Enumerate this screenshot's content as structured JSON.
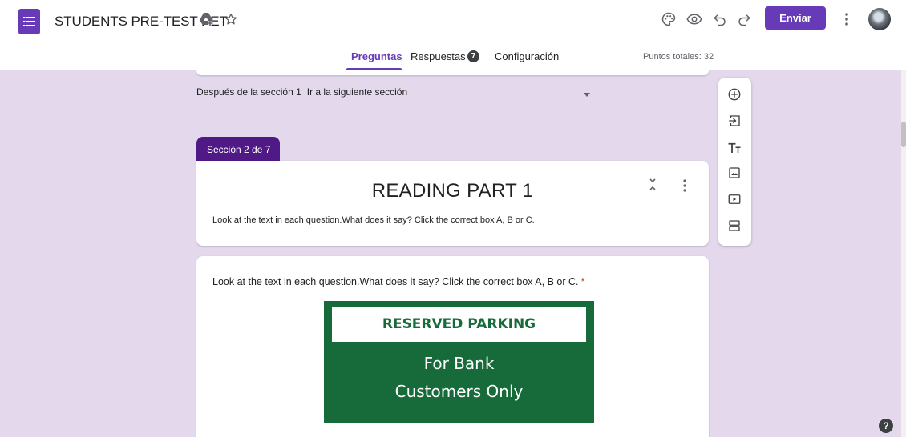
{
  "header": {
    "title": "STUDENTS PRE-TEST PET",
    "send_label": "Enviar",
    "icons": [
      "forms-logo-icon",
      "drive-icon",
      "star-icon",
      "palette-icon",
      "preview-icon",
      "undo-icon",
      "redo-icon",
      "more-vert-icon"
    ]
  },
  "tabs": {
    "questions": "Preguntas",
    "responses": "Respuestas",
    "responses_count": "7",
    "settings": "Configuración",
    "total_points": "Puntos totales: 32"
  },
  "navigation": {
    "after_section_label": "Después de la sección 1",
    "after_section_value": "Ir a la siguiente sección"
  },
  "section": {
    "tab_label": "Sección 2 de 7",
    "title": "READING PART 1",
    "description": "Look at the text in each question.What does it say? Click the correct box A, B or C."
  },
  "question": {
    "text": "Look at the text in each question.What does it say? Click the correct box A, B or C.",
    "required_mark": "*",
    "image": {
      "banner": "RESERVED PARKING",
      "line1": "For Bank",
      "line2": "Customers Only"
    }
  },
  "toolbar": {
    "tools": [
      "add-question-icon",
      "import-questions-icon",
      "add-title-icon",
      "add-image-icon",
      "add-video-icon",
      "add-section-icon"
    ]
  },
  "help": "?",
  "colors": {
    "accent": "#673ab7",
    "section_tab": "#4f1a85",
    "background": "#e4d8ec",
    "sign_green": "#176a3a",
    "required": "#d93025"
  }
}
